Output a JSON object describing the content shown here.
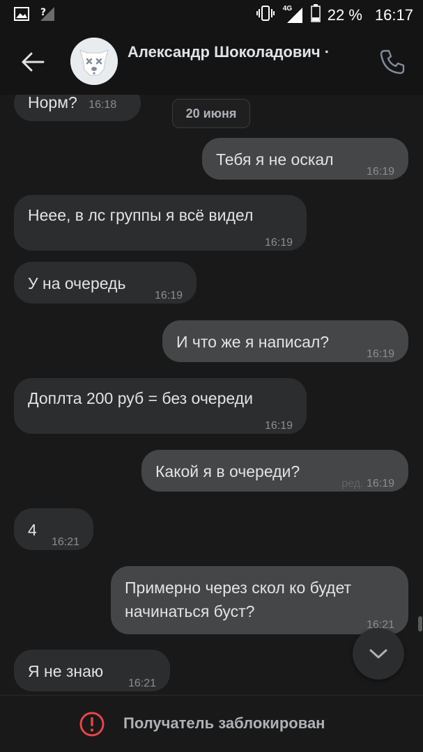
{
  "status_bar": {
    "network": "4G",
    "battery": "22 %",
    "time": "16:17"
  },
  "header": {
    "contact_name": "Александр Шоколадович ·",
    "back_icon": "arrow-left-icon",
    "call_icon": "phone-icon"
  },
  "date_separator": "20 июня",
  "messages": [
    {
      "dir": "in",
      "text": "Норм?",
      "time": "16:18"
    },
    {
      "dir": "out",
      "text": "Тебя я не оскал",
      "time": "16:19"
    },
    {
      "dir": "in",
      "text": "Нееe, в лс группы я всё видел",
      "time": "16:19"
    },
    {
      "dir": "in",
      "text": "У на очередь",
      "time": "16:19"
    },
    {
      "dir": "out",
      "text": "И что же я написал?",
      "time": "16:19"
    },
    {
      "dir": "in",
      "text": "Доплта 200 руб = без очереди",
      "time": "16:19"
    },
    {
      "dir": "out",
      "text": "Какой я в очереди?",
      "edited": "ред.",
      "time": "16:19"
    },
    {
      "dir": "in",
      "text": "4",
      "time": "16:21"
    },
    {
      "dir": "out",
      "text_line1": "Примерно через скол ко будет",
      "text_line2": "начинаться буст?",
      "time": "16:21"
    },
    {
      "dir": "in",
      "text": "Я не знаю",
      "time": "16:21"
    }
  ],
  "footer": {
    "blocked_text": "Получатель заблокирован",
    "blocked_icon": "alert-circle-icon"
  },
  "colors": {
    "background": "#191919",
    "bubble_in": "#2c2d2e",
    "bubble_out": "#454647",
    "alert": "#e64646"
  }
}
